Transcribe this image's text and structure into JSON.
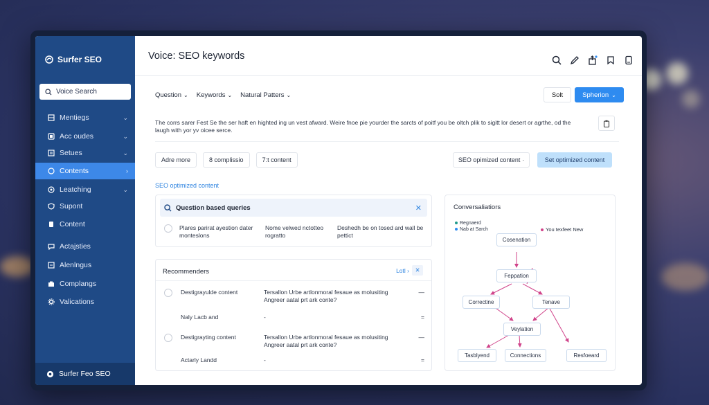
{
  "sidebar": {
    "brand": "Surfer SEO",
    "search_placeholder": "Voice Search",
    "items": [
      {
        "label": "Mentiegs",
        "icon": "grid-icon",
        "chevron": "⌄"
      },
      {
        "label": "Acc oudes",
        "icon": "box-icon",
        "chevron": "⌄"
      },
      {
        "label": "Setues",
        "icon": "settings-icon",
        "chevron": "⌄"
      },
      {
        "label": "Contents",
        "icon": "chat-icon",
        "chevron": "›",
        "active": true
      },
      {
        "label": "Leatching",
        "icon": "target-icon",
        "chevron": "⌄"
      },
      {
        "label": "Supont",
        "icon": "shield-icon",
        "chevron": ""
      },
      {
        "label": "Content",
        "icon": "doc-icon",
        "chevron": ""
      },
      {
        "label": "Actajsties",
        "icon": "chat-icon",
        "chevron": ""
      },
      {
        "label": "Alenlngus",
        "icon": "list-icon",
        "chevron": ""
      },
      {
        "label": "Complangs",
        "icon": "camera-icon",
        "chevron": ""
      },
      {
        "label": "Valications",
        "icon": "gear-icon",
        "chevron": ""
      }
    ],
    "footer": "Surfer Feo SEO"
  },
  "header": {
    "title": "Voice: SEO keywords"
  },
  "filters": [
    {
      "label": "Question"
    },
    {
      "label": "Keywords"
    },
    {
      "label": "Natural Patters"
    }
  ],
  "actions": {
    "soft_label": "Solt",
    "primary_label": "Spherion"
  },
  "description": "The corrs sarer Fest Se the ser haft en highted ing un vest afward. Weire fnoe pie yourder the sarcts of poitf you be oltch plik to sigitt lor desert or agrthe, od the laugh with yor yv oicee serce.",
  "chips": [
    "Adre more",
    "8 complissio",
    "7:t content"
  ],
  "chip_select": "SEO opimized content",
  "chip_blue": "Set optimized content",
  "section_link": "SEO optimized content",
  "questions": {
    "title": "Question based queries",
    "row": {
      "col1": [
        "Plares parirat ayestion dater",
        "monteslons"
      ],
      "col2": [
        "Nome velwed nctotteo",
        "rogratto"
      ],
      "col3": [
        "Deshedh be on tosed ard wall be",
        "pettict"
      ]
    }
  },
  "recommendations": {
    "title": "Recommenders",
    "ctrl_label": "Lotl",
    "rows": [
      {
        "title": "Destigrayulde content",
        "desc": [
          "Tersallon Urbe artlonmoral fesaue as molusiting",
          "Angreer aatal prt ark conte?"
        ],
        "end": "—",
        "radio": true
      },
      {
        "title": "Naly Lacb and",
        "desc": [
          "-"
        ],
        "end": "=",
        "radio": false
      },
      {
        "title": "Destigrayting content",
        "desc": [
          "Tersallon Urbe artlonmoral fesaue as molusiting",
          "Angreer aatal prt ark conte?"
        ],
        "end": "—",
        "radio": true
      },
      {
        "title": "Actarly Landd",
        "desc": [
          "-"
        ],
        "end": "=",
        "radio": false
      }
    ]
  },
  "conversations": {
    "title": "Conversaliatiors",
    "legend": [
      "Regnaerd",
      "Nab at Sarch"
    ],
    "legend_right": "You texfeet New",
    "nodes": {
      "n1": "Cosenation",
      "n2": "Feppation",
      "n3": "Correctine",
      "n4": "Tenave",
      "n5": "Veylation",
      "n6": "Tasblyend",
      "n7": "Connections",
      "n8": "Resfoeard"
    }
  },
  "colors": {
    "sidebar": "#1f4a86",
    "accent": "#2e8bf0",
    "edge": "#d0438a"
  }
}
